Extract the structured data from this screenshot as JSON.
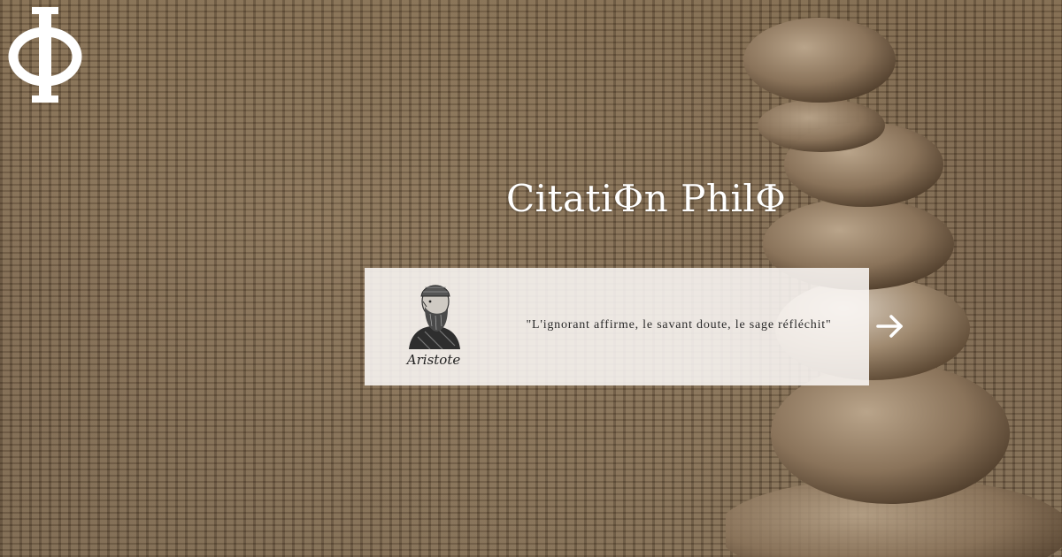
{
  "logo": {
    "glyph": "Φ",
    "icon": "phi-logo-icon"
  },
  "header": {
    "title": "CitatiΦn PhilΦ"
  },
  "quote": {
    "author": "Aristote",
    "text": "\"L'ignorant affirme, le savant doute, le sage réfléchit\"",
    "portrait_icon": "aristotle-portrait-icon"
  },
  "navigation": {
    "next_icon": "arrow-right-icon"
  },
  "colors": {
    "background": "#6f5b45",
    "card": "#faf7f5",
    "title": "#ffffff",
    "text": "#2b2b2b"
  }
}
